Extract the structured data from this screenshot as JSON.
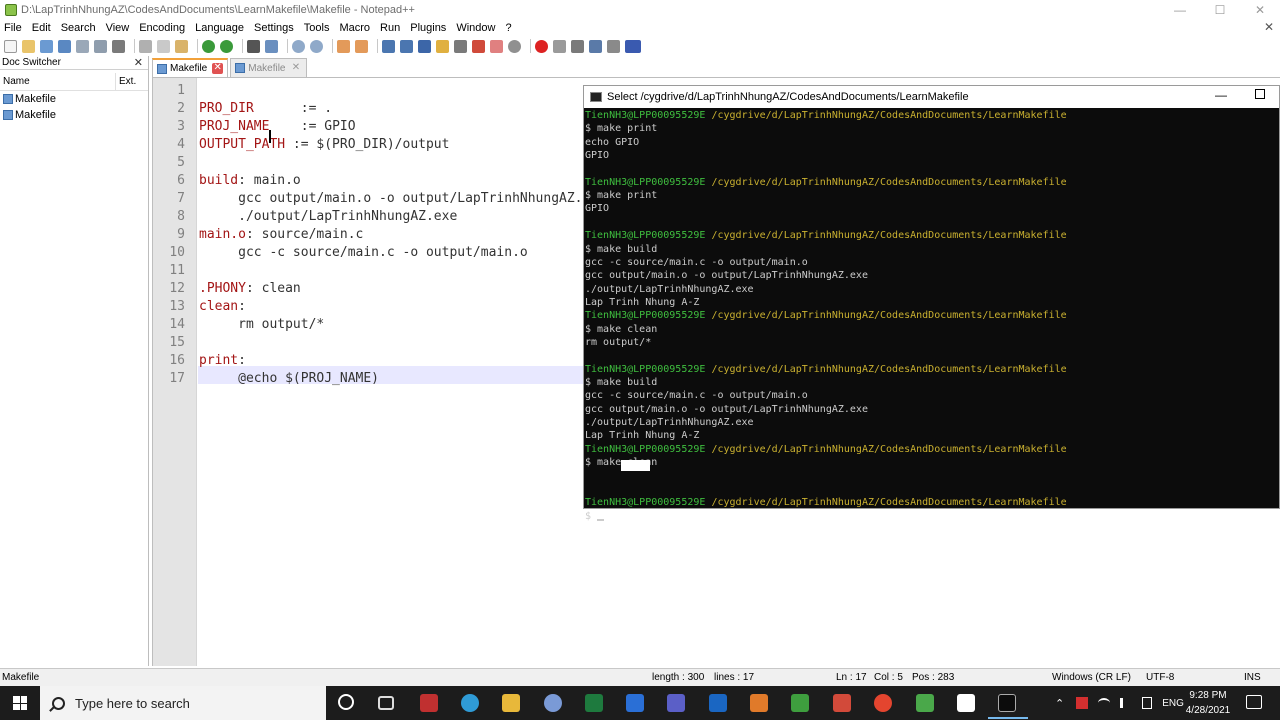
{
  "window": {
    "title": "D:\\LapTrinhNhungAZ\\CodesAndDocuments\\LearnMakefile\\Makefile - Notepad++",
    "min_glyph": "—",
    "max_glyph": "☐",
    "close_glyph": "✕"
  },
  "menu": {
    "items": [
      "File",
      "Edit",
      "Search",
      "View",
      "Encoding",
      "Language",
      "Settings",
      "Tools",
      "Macro",
      "Run",
      "Plugins",
      "Window",
      "?"
    ],
    "close_glyph": "✕"
  },
  "doc_switcher": {
    "title": "Doc Switcher",
    "close_glyph": "✕",
    "columns": [
      "Name",
      "Ext."
    ],
    "items": [
      "Makefile",
      "Makefile"
    ]
  },
  "tabs": [
    {
      "label": "Makefile",
      "close_glyph": "✕"
    },
    {
      "label": "Makefile",
      "close_glyph": "✕"
    }
  ],
  "editor": {
    "line_numbers": [
      "1",
      "2",
      "3",
      "4",
      "5",
      "6",
      "7",
      "8",
      "9",
      "10",
      "11",
      "12",
      "13",
      "14",
      "15",
      "16",
      "17"
    ],
    "lines": [
      {
        "k": "",
        "t": ""
      },
      {
        "k": "PRO_DIR",
        "t": "      := ."
      },
      {
        "k": "PROJ_NAME",
        "t": "    := GPIO"
      },
      {
        "k": "OUTPUT_PATH",
        "t": " := $(PRO_DIR)/output"
      },
      {
        "k": "",
        "t": ""
      },
      {
        "k": "build",
        "t": ": main.o"
      },
      {
        "k": "",
        "t": "     gcc output/main.o -o output/LapTrinhNhungAZ.exe"
      },
      {
        "k": "",
        "t": "     ./output/LapTrinhNhungAZ.exe"
      },
      {
        "k": "main.o",
        "t": ": source/main.c"
      },
      {
        "k": "",
        "t": "     gcc -c source/main.c -o output/main.o"
      },
      {
        "k": "",
        "t": ""
      },
      {
        "k": ".PHONY",
        "t": ": clean"
      },
      {
        "k": "clean",
        "t": ":"
      },
      {
        "k": "",
        "t": "     rm output/*"
      },
      {
        "k": "",
        "t": ""
      },
      {
        "k": "print",
        "t": ":"
      },
      {
        "k": "",
        "t": "     @echo $(PROJ_NAME)"
      }
    ]
  },
  "terminal": {
    "title": "Select /cygdrive/d/LapTrinhNhungAZ/CodesAndDocuments/LearnMakefile",
    "min_glyph": "—",
    "lines": [
      {
        "u": "TienNH3@LPP00095529E",
        "p": " /cygdrive/d/LapTrinhNhungAZ/CodesAndDocuments/LearnMakefile",
        "t": ""
      },
      {
        "u": "",
        "p": "",
        "t": "$ make print"
      },
      {
        "u": "",
        "p": "",
        "t": "echo GPIO"
      },
      {
        "u": "",
        "p": "",
        "t": "GPIO"
      },
      {
        "u": "",
        "p": "",
        "t": ""
      },
      {
        "u": "TienNH3@LPP00095529E",
        "p": " /cygdrive/d/LapTrinhNhungAZ/CodesAndDocuments/LearnMakefile",
        "t": ""
      },
      {
        "u": "",
        "p": "",
        "t": "$ make print"
      },
      {
        "u": "",
        "p": "",
        "t": "GPIO"
      },
      {
        "u": "",
        "p": "",
        "t": ""
      },
      {
        "u": "TienNH3@LPP00095529E",
        "p": " /cygdrive/d/LapTrinhNhungAZ/CodesAndDocuments/LearnMakefile",
        "t": ""
      },
      {
        "u": "",
        "p": "",
        "t": "$ make build"
      },
      {
        "u": "",
        "p": "",
        "t": "gcc -c source/main.c -o output/main.o"
      },
      {
        "u": "",
        "p": "",
        "t": "gcc output/main.o -o output/LapTrinhNhungAZ.exe"
      },
      {
        "u": "",
        "p": "",
        "t": "./output/LapTrinhNhungAZ.exe"
      },
      {
        "u": "",
        "p": "",
        "t": "Lap Trinh Nhung A-Z"
      },
      {
        "u": "TienNH3@LPP00095529E",
        "p": " /cygdrive/d/LapTrinhNhungAZ/CodesAndDocuments/LearnMakefile",
        "t": ""
      },
      {
        "u": "",
        "p": "",
        "t": "$ make clean"
      },
      {
        "u": "",
        "p": "",
        "t": "rm output/*"
      },
      {
        "u": "",
        "p": "",
        "t": ""
      },
      {
        "u": "TienNH3@LPP00095529E",
        "p": " /cygdrive/d/LapTrinhNhungAZ/CodesAndDocuments/LearnMakefile",
        "t": ""
      },
      {
        "u": "",
        "p": "",
        "t": "$ make build"
      },
      {
        "u": "",
        "p": "",
        "t": "gcc -c source/main.c -o output/main.o"
      },
      {
        "u": "",
        "p": "",
        "t": "gcc output/main.o -o output/LapTrinhNhungAZ.exe"
      },
      {
        "u": "",
        "p": "",
        "t": "./output/LapTrinhNhungAZ.exe"
      },
      {
        "u": "",
        "p": "",
        "t": "Lap Trinh Nhung A-Z"
      },
      {
        "u": "TienNH3@LPP00095529E",
        "p": " /cygdrive/d/LapTrinhNhungAZ/CodesAndDocuments/LearnMakefile",
        "t": ""
      },
      {
        "u": "",
        "p": "",
        "t": "$ make clean"
      },
      {
        "u": "",
        "p": "",
        "t": ""
      },
      {
        "u": "",
        "p": "",
        "t": ""
      },
      {
        "u": "TienNH3@LPP00095529E",
        "p": " /cygdrive/d/LapTrinhNhungAZ/CodesAndDocuments/LearnMakefile",
        "t": ""
      },
      {
        "u": "",
        "p": "",
        "t": "$ "
      }
    ]
  },
  "status": {
    "file_type": "Makefile",
    "length": "length : 300",
    "lines": "lines : 17",
    "ln": "Ln : 17",
    "col": "Col : 5",
    "pos": "Pos : 283",
    "eol": "Windows (CR LF)",
    "encoding": "UTF-8",
    "mode": "INS"
  },
  "taskbar": {
    "search_placeholder": "Type here to search",
    "time": "9:28 PM",
    "date": "4/28/2021",
    "lang": "ENG",
    "tray_up_glyph": "⌃"
  },
  "colors": {
    "keyword": "#a31515",
    "terminal_user": "#3fbf3f",
    "terminal_path": "#c9b030",
    "current_line": "#e8e8ff",
    "tab_accent": "#f2a13a"
  },
  "icons": {
    "toolbar": [
      "new-file-icon",
      "open-icon",
      "save-icon",
      "save-all-icon",
      "close-icon",
      "close-all-icon",
      "print-icon",
      "cut-icon",
      "copy-icon",
      "paste-icon",
      "undo-icon",
      "redo-icon",
      "find-icon",
      "replace-icon",
      "zoom-in-icon",
      "zoom-out-icon",
      "sync-v-icon",
      "sync-h-icon",
      "wrap-icon",
      "all-chars-icon",
      "indent-guide-icon",
      "udl-icon",
      "doc-map-icon",
      "function-list-icon",
      "folder-workspace-icon",
      "monitor-icon",
      "record-macro-icon",
      "stop-macro-icon",
      "play-macro-icon",
      "run-macro-multiple-icon",
      "save-macro-icon",
      "spellcheck-icon"
    ],
    "taskbar": [
      "cortana-icon",
      "task-view-icon",
      "app-icon-1",
      "chrome-like-icon",
      "file-explorer-icon",
      "vscode-icon",
      "excel-icon",
      "ide-icon",
      "teams-icon",
      "outlook-icon",
      "app-icon-2",
      "app-icon-3",
      "app-icon-4",
      "chrome-icon",
      "app-icon-5",
      "terminal-icon"
    ]
  }
}
